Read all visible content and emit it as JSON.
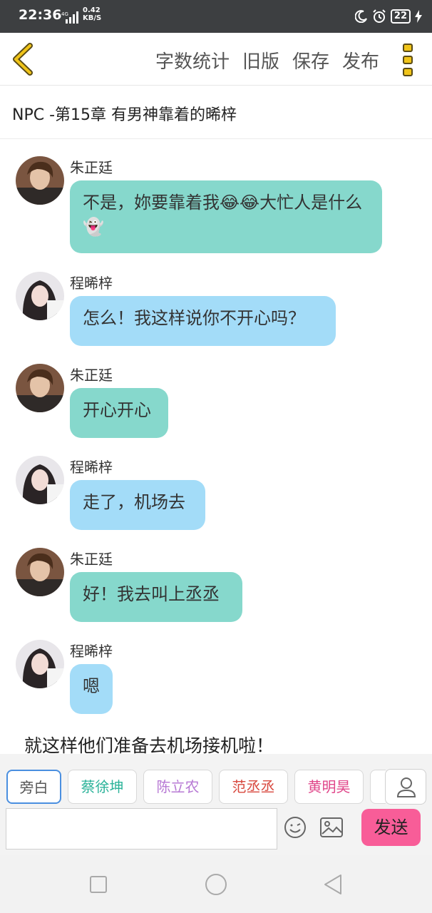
{
  "status_bar": {
    "time": "22:36",
    "network_type": "4G",
    "net_speed_value": "0.42",
    "net_speed_unit": "KB/S",
    "battery": "22"
  },
  "header": {
    "actions": [
      "字数统计",
      "旧版",
      "保存",
      "发布"
    ],
    "accent_color": "#f0c419"
  },
  "chapter_title": "NPC -第15章 有男神靠着的晞梓",
  "messages": [
    {
      "sender": "朱正廷",
      "text": "不是，妳要靠着我😂😂大忙人是什么👻",
      "color": "#86d8cc"
    },
    {
      "sender": "程晞梓",
      "text": "怎么！我这样说你不开心吗？",
      "color": "#a3dcf8"
    },
    {
      "sender": "朱正廷",
      "text": "开心开心",
      "color": "#86d8cc"
    },
    {
      "sender": "程晞梓",
      "text": "走了，机场去",
      "color": "#a3dcf8"
    },
    {
      "sender": "朱正廷",
      "text": "好！我去叫上丞丞",
      "color": "#86d8cc"
    },
    {
      "sender": "程晞梓",
      "text": "嗯",
      "color": "#a3dcf8"
    }
  ],
  "narration": "就这样他们准备去机场接机啦！",
  "composer": {
    "roles": [
      {
        "label": "旁白",
        "color": "#555555",
        "selected": true
      },
      {
        "label": "蔡徐坤",
        "color": "#2cb39a",
        "selected": false
      },
      {
        "label": "陈立农",
        "color": "#b779d4",
        "selected": false
      },
      {
        "label": "范丞丞",
        "color": "#d8483e",
        "selected": false
      },
      {
        "label": "黄明昊",
        "color": "#e0468a",
        "selected": false
      }
    ],
    "input_value": "",
    "send_label": "发送",
    "send_color": "#f85d98"
  }
}
